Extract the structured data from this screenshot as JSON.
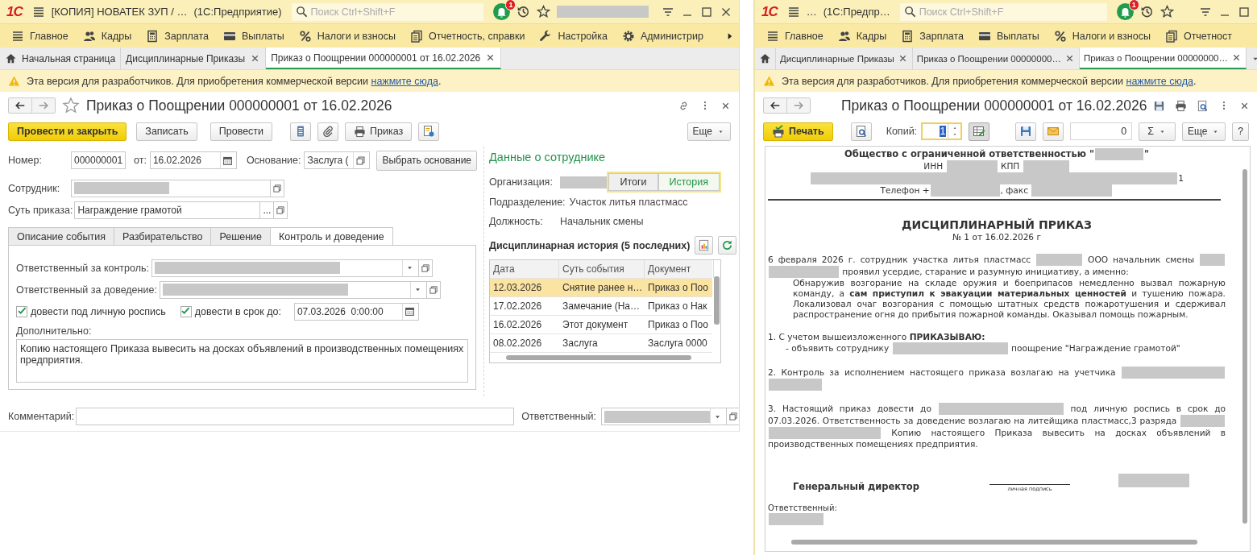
{
  "left_window": {
    "kind": "form",
    "logo": "1С",
    "title": "[КОПИЯ] НОВАТЕК ЗУП / …",
    "app": "(1С:Предприятие)",
    "search_placeholder": "Поиск Ctrl+Shift+F",
    "notification_count": "1",
    "user_redacted": true,
    "window_close": true,
    "sections": [
      {
        "label": "Главное"
      },
      {
        "label": "Кадры"
      },
      {
        "label": "Зарплата"
      },
      {
        "label": "Выплаты"
      },
      {
        "label": "Налоги и взносы"
      },
      {
        "label": "Отчетность, справки"
      },
      {
        "label": "Настройка"
      },
      {
        "label": "Администрир"
      }
    ],
    "section_scroll": true,
    "tabs": [
      {
        "kind": "home",
        "label": "Начальная страница",
        "closable": false,
        "selected": false
      },
      {
        "kind": "page",
        "label": "Дисциплинарные Приказы",
        "closable": true,
        "selected": false
      },
      {
        "kind": "page",
        "label": "Приказ о Поощрении 000000001 от 16.02.2026",
        "closable": true,
        "selected": true
      }
    ],
    "tabs_menu": false,
    "banner": {
      "text": "Эта версия для разработчиков. Для приобретения коммерческой версии",
      "link": "нажмите сюда",
      "end": "."
    },
    "form": {
      "title": "Приказ о Поощрении 000000001 от 16.02.2026",
      "toolbar": [
        {
          "kind": "primary",
          "label": "Провести и закрыть"
        },
        {
          "kind": "button",
          "label": "Записать"
        },
        {
          "kind": "button",
          "label": "Провести"
        },
        {
          "kind": "icon"
        },
        {
          "kind": "icon"
        },
        {
          "kind": "icon_text",
          "label": "Приказ"
        },
        {
          "kind": "icon"
        }
      ],
      "more": "Еще",
      "number": {
        "label": "Номер:",
        "value": "000000001"
      },
      "date": {
        "label": "от:",
        "value": "16.02.2026"
      },
      "basis": {
        "label": "Основание:",
        "value": "Заслуга (",
        "button": "Выбрать основание"
      },
      "employee": {
        "label": "Сотрудник:",
        "redacted": true
      },
      "essence": {
        "label": "Суть приказа:",
        "value": "Награждение грамотой",
        "select_button": "..."
      },
      "inner_tabs": [
        {
          "label": "Описание события",
          "selected": false
        },
        {
          "label": "Разбирательство",
          "selected": false
        },
        {
          "label": "Решение",
          "selected": false
        },
        {
          "label": "Контроль и доведение",
          "selected": true
        }
      ],
      "control": {
        "label": "Ответственный за контроль:",
        "redacted": true
      },
      "delivery": {
        "label": "Ответственный за доведение:",
        "redacted": true
      },
      "checks": [
        {
          "label": "довести под личную роспись",
          "checked": true
        },
        {
          "label": "довести в срок до:",
          "checked": true
        }
      ],
      "deadline": {
        "value": "07.03.2026  0:00:00"
      },
      "extra": {
        "label": "Дополнительно:",
        "value": "Копию настоящего Приказа вывесить на досках объявлений в производственных помещениях предприятия."
      },
      "comment": {
        "label": "Комментарий:"
      },
      "responsible": {
        "label": "Ответственный:",
        "redacted": true
      },
      "employee_panel": {
        "title": "Данные о сотруднике",
        "organization": {
          "label": "Организация:",
          "redacted": true
        },
        "views": [
          {
            "label": "Итоги",
            "selected": false
          },
          {
            "label": "История",
            "selected": true
          }
        ],
        "department": {
          "label": "Подразделение:",
          "value": "Участок литья пластмасс"
        },
        "position": {
          "label": "Должность:",
          "value": "Начальник смены"
        },
        "history_title": "Дисциплинарная история (5 последних)",
        "table": {
          "columns": [
            "Дата",
            "Суть события",
            "Документ"
          ],
          "rows": [
            {
              "cells": [
                "12.03.2026",
                "Снятие ранее н…",
                "Приказ о Поо"
              ],
              "selected": true
            },
            {
              "cells": [
                "17.02.2026",
                "Замечание (На…",
                "Приказ о Нак"
              ],
              "selected": false
            },
            {
              "cells": [
                "16.02.2026",
                "Этот документ",
                "Приказ о Поо"
              ],
              "selected": false
            },
            {
              "cells": [
                "08.02.2026",
                "Заслуга",
                "Заслуга 0000"
              ],
              "selected": false
            }
          ]
        }
      }
    }
  },
  "right_window": {
    "kind": "print",
    "logo": "1С",
    "title": "…",
    "app": "(1С:Предпр…",
    "search_placeholder": "Поиск Ctrl+Shift+F",
    "notification_count": "1",
    "user_redacted": false,
    "window_close": false,
    "sections": [
      {
        "label": "Главное"
      },
      {
        "label": "Кадры"
      },
      {
        "label": "Зарплата"
      },
      {
        "label": "Выплаты"
      },
      {
        "label": "Налоги и взносы"
      },
      {
        "label": "Отчетност"
      }
    ],
    "section_scroll": false,
    "tabs": [
      {
        "kind": "home",
        "closable": false,
        "selected": false
      },
      {
        "kind": "page",
        "label": "Дисциплинарные Приказы",
        "closable": true,
        "selected": false
      },
      {
        "kind": "page",
        "label": "Приказ о Поощрении 00000000…",
        "closable": true,
        "selected": false
      },
      {
        "kind": "page",
        "label": "Приказ о Поощрении 00000000…",
        "closable": true,
        "selected": true
      }
    ],
    "tabs_menu": true,
    "banner": {
      "text": "Эта версия для разработчиков. Для приобретения коммерческой версии",
      "link": "нажмите сюда",
      "end": "."
    },
    "form": {
      "title": "Приказ о Поощрении 000000001 от 16.02.2026",
      "toolbar": [
        {
          "kind": "primary",
          "label": "Печать"
        },
        {
          "kind": "icon"
        },
        {
          "kind": "label",
          "label": "Копий:"
        },
        {
          "kind": "spin",
          "value": "1"
        },
        {
          "kind": "toggle",
          "pressed": true
        },
        {
          "kind": "icon"
        },
        {
          "kind": "icon"
        },
        {
          "kind": "sum",
          "value": "0"
        },
        {
          "kind": "menu",
          "label": "Σ"
        }
      ],
      "more": "Еще",
      "help": "?",
      "document": {
        "blocks": [
          {
            "kind": "org",
            "parts": [
              {
                "kind": "text",
                "text": "Общество с ограниченной ответственностью \""
              },
              {
                "kind": "redacted"
              },
              {
                "kind": "text",
                "text": "\""
              }
            ]
          },
          {
            "kind": "center",
            "parts": [
              {
                "kind": "text",
                "text": "ИНН "
              },
              {
                "kind": "redacted"
              },
              {
                "kind": "text",
                "text": " КПП "
              },
              {
                "kind": "redacted"
              }
            ]
          },
          {
            "kind": "center",
            "parts": [
              {
                "kind": "redacted"
              },
              {
                "kind": "text",
                "text": "1"
              }
            ]
          },
          {
            "kind": "center",
            "parts": [
              {
                "kind": "text",
                "text": "Телефон +"
              },
              {
                "kind": "redacted"
              },
              {
                "kind": "text",
                "text": ", факс "
              },
              {
                "kind": "redacted"
              }
            ]
          },
          {
            "kind": "rule"
          },
          {
            "kind": "title",
            "parts": [
              {
                "kind": "text",
                "text": "ДИСЦИПЛИНАРНЫЙ ПРИКАЗ"
              }
            ]
          },
          {
            "kind": "subtitle",
            "parts": [
              {
                "kind": "text",
                "text": "№ 1 от 16.02.2026 г"
              }
            ]
          },
          {
            "kind": "para",
            "parts": [
              {
                "kind": "text",
                "text": "6 февраля 2026 г. сотрудник участка литья пластмасс "
              },
              {
                "kind": "redacted"
              },
              {
                "kind": "text",
                "text": " ООО начальник смены "
              },
              {
                "kind": "redacted"
              },
              {
                "kind": "redacted"
              },
              {
                "kind": "text",
                "text": " проявил усердие, старание и разумную инициативу, а именно:"
              }
            ]
          },
          {
            "kind": "indent",
            "parts": [
              {
                "kind": "text",
                "text": "Обнаружив возгорание на складе оружия и боеприпасов немедленно вызвал пожарную команду, а **сам приступил к эвакуации материальных ценностей** и тушению пожара. Локализовал очаг возгорания с помощью штатных средств пожаротушения и сдерживал распространение огня до прибытия пожарной команды. Оказывал помощь пожарным."
              }
            ]
          },
          {
            "kind": "para",
            "parts": [
              {
                "kind": "text",
                "text": "1. С учетом вышеизложенного **ПРИКАЗЫВАЮ:**"
              }
            ]
          },
          {
            "kind": "item",
            "parts": [
              {
                "kind": "text",
                "text": "- объявить сотруднику "
              },
              {
                "kind": "redacted"
              },
              {
                "kind": "text",
                "text": " поощрение \"Награждение грамотой\""
              }
            ]
          },
          {
            "kind": "para",
            "parts": [
              {
                "kind": "text",
                "text": "2. Контроль за исполнением настоящего приказа возлагаю на учетчика "
              },
              {
                "kind": "redacted"
              },
              {
                "kind": "redacted"
              }
            ]
          },
          {
            "kind": "para",
            "parts": [
              {
                "kind": "text",
                "text": "3. Настоящий приказ довести до "
              },
              {
                "kind": "redacted"
              },
              {
                "kind": "text",
                "text": " под личную роспись в срок до 07.03.2026. Ответственность за доведение возлагаю на литейщика пластмасс,3 разряда "
              },
              {
                "kind": "redacted"
              },
              {
                "kind": "redacted"
              },
              {
                "kind": "text",
                "text": " Копию настоящего Приказа вывесить на досках объявлений в производственных помещениях предприятия."
              }
            ]
          },
          {
            "kind": "signature",
            "position": "Генеральный директор",
            "caption": "личная подпись",
            "redacted": true
          },
          {
            "kind": "small",
            "parts": [
              {
                "kind": "text",
                "text": "Ответственный:"
              }
            ]
          },
          {
            "kind": "small",
            "parts": [
              {
                "kind": "redacted"
              }
            ]
          }
        ]
      }
    }
  }
}
